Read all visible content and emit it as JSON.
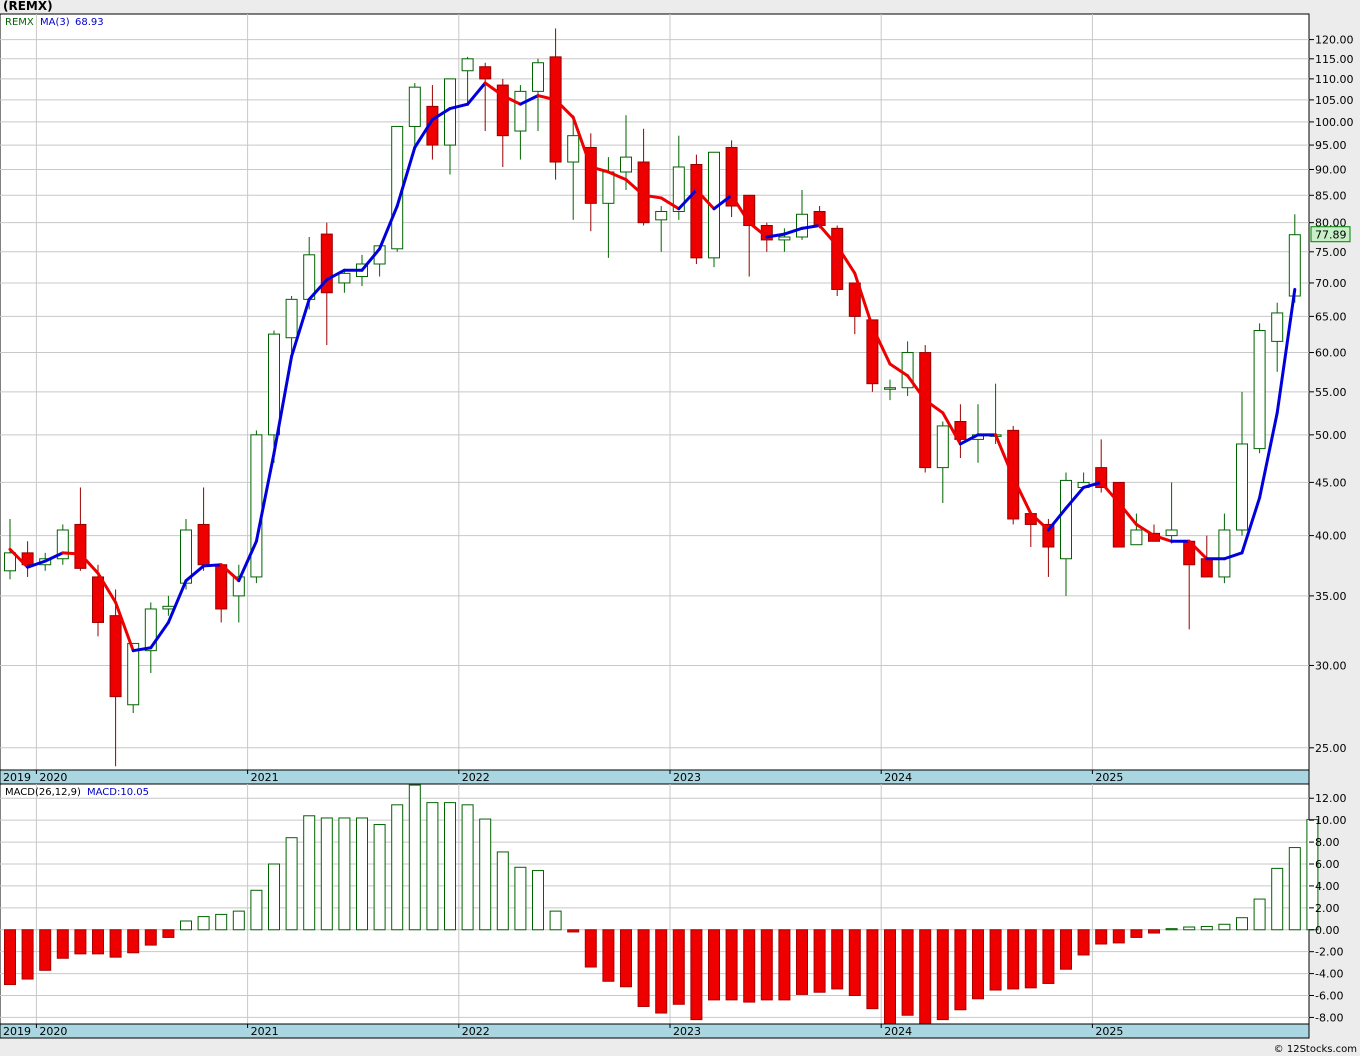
{
  "title": "(REMX)",
  "credit": "© 12Stocks.com",
  "colors": {
    "up_body": "#ffffff",
    "up_stroke": "#006400",
    "down_body": "#ee0000",
    "down_stroke": "#990000",
    "ma_up": "#0000dd",
    "ma_down": "#ee0000",
    "axis_band": "#a9d6e0",
    "macd_pos": "#ffffff",
    "macd_pos_stroke": "#006400",
    "macd_neg": "#ee0000",
    "last_price_bg": "#c8f0c8"
  },
  "chart_data": [
    {
      "type": "candlestick",
      "legend": {
        "symbol": "REMX",
        "ma_label": "MA(3)",
        "ma_value": "68.93"
      },
      "last_price_label": "77.89",
      "y_scale": "log",
      "ylim": [
        23.8,
        127
      ],
      "y_ticks": [
        "25.00",
        "30.00",
        "35.00",
        "40.00",
        "45.00",
        "50.00",
        "55.00",
        "60.00",
        "65.00",
        "70.00",
        "75.00",
        "80.00",
        "85.00",
        "90.00",
        "95.00",
        "100.00",
        "105.00",
        "110.00",
        "115.00",
        "120.00"
      ],
      "x_labels": [
        "2019",
        "2020",
        "2021",
        "2022",
        "2023",
        "2024",
        "2025"
      ],
      "months_per_year": 12,
      "first_bar": "2019-11",
      "ohlc": [
        [
          37,
          41.5,
          36.3,
          38.5
        ],
        [
          38.5,
          39.5,
          36.5,
          37.5
        ],
        [
          37.5,
          38.5,
          37,
          38
        ],
        [
          38,
          41,
          37.5,
          40.5
        ],
        [
          41,
          44.5,
          37,
          37.2
        ],
        [
          36.5,
          37.5,
          32,
          33
        ],
        [
          33.5,
          35.5,
          24,
          28
        ],
        [
          27.5,
          31.5,
          27,
          31.5
        ],
        [
          31,
          34.5,
          29.5,
          34
        ],
        [
          34,
          35,
          33.5,
          34.2
        ],
        [
          36,
          41.5,
          35.5,
          40.5
        ],
        [
          41,
          44.5,
          37,
          37.5
        ],
        [
          37.5,
          37.5,
          33,
          34
        ],
        [
          35,
          37.5,
          33,
          36.5
        ],
        [
          36.5,
          50.5,
          36,
          50
        ],
        [
          50,
          63,
          47,
          62.5
        ],
        [
          62,
          68,
          60,
          67.5
        ],
        [
          67.5,
          77.5,
          66,
          74.5
        ],
        [
          78,
          80,
          61,
          68.5
        ],
        [
          70,
          72,
          68.5,
          71.5
        ],
        [
          71,
          74.5,
          69.5,
          73
        ],
        [
          73,
          75,
          71,
          76
        ],
        [
          75.5,
          99,
          75,
          99
        ],
        [
          99,
          109,
          95,
          108
        ],
        [
          103.5,
          108.5,
          92,
          95
        ],
        [
          95,
          110,
          89,
          110
        ],
        [
          112,
          115.5,
          104,
          115
        ],
        [
          113,
          114,
          98,
          110
        ],
        [
          108.5,
          110,
          90.5,
          97
        ],
        [
          98,
          108.5,
          92,
          107
        ],
        [
          107,
          115,
          98,
          114
        ],
        [
          115.5,
          123,
          88,
          91.5
        ],
        [
          91.5,
          101.5,
          80.5,
          97
        ],
        [
          94.5,
          97.5,
          78.5,
          83.5
        ],
        [
          83.5,
          92.5,
          74,
          89.5
        ],
        [
          89.5,
          101.5,
          86,
          92.5
        ],
        [
          91.5,
          98.5,
          79.5,
          80
        ],
        [
          80.5,
          83,
          75,
          82
        ],
        [
          82,
          97,
          80.5,
          90.5
        ],
        [
          91,
          93,
          73,
          74
        ],
        [
          74,
          93.5,
          72.5,
          93.5
        ],
        [
          94.5,
          96,
          81,
          83
        ],
        [
          85,
          85,
          71,
          79.5
        ],
        [
          79.5,
          80,
          75,
          77
        ],
        [
          77,
          79,
          75,
          77.5
        ],
        [
          77.5,
          86,
          77,
          81.5
        ],
        [
          82,
          83,
          79,
          79.5
        ],
        [
          79,
          79.5,
          68,
          69
        ],
        [
          70,
          70,
          62.5,
          65
        ],
        [
          64.5,
          64.5,
          55,
          56
        ],
        [
          55.5,
          56.5,
          54,
          55.5
        ],
        [
          55.5,
          61.5,
          54.5,
          60
        ],
        [
          60,
          61,
          46,
          46.5
        ],
        [
          46.5,
          51.5,
          43,
          51
        ],
        [
          51.5,
          53.5,
          47.5,
          49.5
        ],
        [
          49.5,
          53.5,
          47,
          50
        ],
        [
          50,
          56,
          49,
          50
        ],
        [
          50.5,
          51,
          41,
          41.5
        ],
        [
          42,
          42,
          39,
          41
        ],
        [
          41,
          41.5,
          36.5,
          39
        ],
        [
          38,
          46,
          35,
          45.2
        ],
        [
          44.5,
          46,
          44.5,
          45
        ],
        [
          46.5,
          49.5,
          44,
          44.5
        ],
        [
          45,
          45,
          39,
          39
        ],
        [
          39.2,
          42,
          39.2,
          40.5
        ],
        [
          40.2,
          41,
          39.5,
          39.5
        ],
        [
          40,
          45,
          39.3,
          40.5
        ],
        [
          39.5,
          39.5,
          32.5,
          37.5
        ],
        [
          38,
          40,
          36.5,
          36.5
        ],
        [
          36.5,
          42,
          36,
          40.5
        ],
        [
          40.5,
          55,
          40,
          49
        ],
        [
          48.5,
          64,
          48,
          63
        ],
        [
          61.5,
          67,
          57.5,
          65.5
        ],
        [
          68,
          81.5,
          67,
          77.89
        ]
      ],
      "ma3": [
        38.8,
        37.3,
        37.8,
        38.5,
        38.4,
        36.8,
        34.5,
        31,
        31.2,
        33,
        36.2,
        37.4,
        37.5,
        36.2,
        39.5,
        48,
        59.5,
        67.5,
        70.5,
        72,
        72,
        75.5,
        83,
        94.5,
        100.5,
        103,
        104,
        109,
        106,
        104,
        106,
        105,
        101,
        90.5,
        89.5,
        88,
        85,
        84.5,
        82.5,
        86,
        82.5,
        85,
        80,
        77.5,
        78,
        79,
        79.5,
        76,
        71.5,
        63.5,
        58.5,
        57,
        54,
        52.5,
        49,
        50,
        50,
        45.5,
        42,
        40.5,
        42.5,
        44.5,
        45,
        43,
        41,
        40,
        39.5,
        39.5,
        38,
        38,
        38.5,
        43.5,
        52.5,
        69
      ]
    },
    {
      "type": "bar",
      "legend": {
        "label": "MACD(26,12,9)",
        "value_label": "MACD:10.05"
      },
      "ylim": [
        -8.6,
        13.3
      ],
      "y_ticks": [
        "-8.00",
        "-6.00",
        "-4.00",
        "-2.00",
        "0.00",
        "2.00",
        "4.00",
        "6.00",
        "8.00",
        "10.00",
        "12.00"
      ],
      "x_labels": [
        "2019",
        "2020",
        "2021",
        "2022",
        "2023",
        "2024",
        "2025"
      ],
      "values": [
        -5,
        -4.5,
        -3.7,
        -2.6,
        -2.2,
        -2.2,
        -2.5,
        -2.1,
        -1.4,
        -0.7,
        0.8,
        1.2,
        1.4,
        1.7,
        3.6,
        6,
        8.4,
        10.4,
        10.2,
        10.2,
        10.2,
        9.6,
        11.4,
        13.2,
        11.6,
        11.6,
        11.4,
        10.1,
        7.1,
        5.7,
        5.4,
        1.7,
        -0.2,
        -3.4,
        -4.7,
        -5.2,
        -7,
        -7.6,
        -6.8,
        -8.2,
        -6.4,
        -6.4,
        -6.6,
        -6.4,
        -6.4,
        -5.9,
        -5.7,
        -5.4,
        -6,
        -7.2,
        -8.6,
        -7.8,
        -8.8,
        -8.2,
        -7.3,
        -6.3,
        -5.5,
        -5.4,
        -5.3,
        -4.9,
        -3.6,
        -2.3,
        -1.3,
        -1.2,
        -0.7,
        -0.3,
        0.1,
        0.25,
        0.3,
        0.5,
        1.1,
        2.8,
        5.6,
        7.5,
        10.05
      ]
    }
  ]
}
